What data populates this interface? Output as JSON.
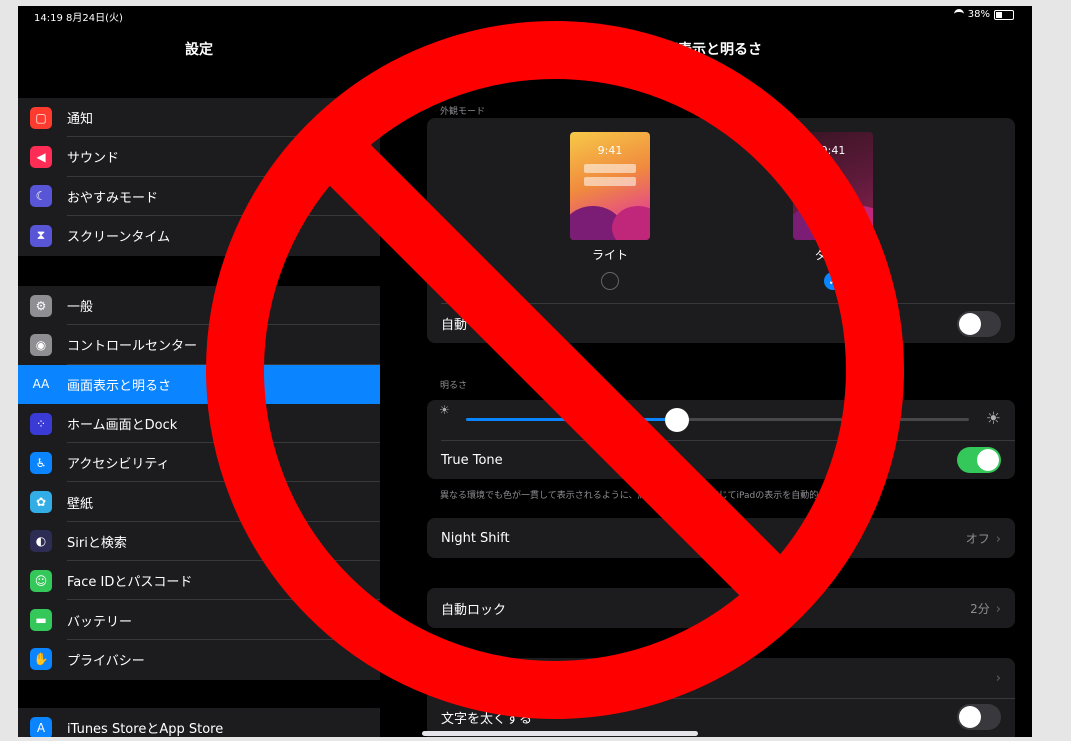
{
  "status": {
    "time": "14:19",
    "date": "8月24日(火)",
    "battery": "38%"
  },
  "sidebar": {
    "title": "設定",
    "groups": [
      [
        {
          "label": "通知",
          "icon": "notification-icon",
          "color": "#ff3b30"
        },
        {
          "label": "サウンド",
          "icon": "sound-icon",
          "color": "#ff2d55"
        },
        {
          "label": "おやすみモード",
          "icon": "moon-icon",
          "color": "#5856d6"
        },
        {
          "label": "スクリーンタイム",
          "icon": "hourglass-icon",
          "color": "#5856d6"
        }
      ],
      [
        {
          "label": "一般",
          "icon": "gear-icon",
          "color": "#8e8e93"
        },
        {
          "label": "コントロールセンター",
          "icon": "switches-icon",
          "color": "#8e8e93"
        },
        {
          "label": "画面表示と明るさ",
          "icon": "text-size-icon",
          "color": "#0a84ff",
          "selected": true
        },
        {
          "label": "ホーム画面とDock",
          "icon": "home-grid-icon",
          "color": "#3a3ad6"
        },
        {
          "label": "アクセシビリティ",
          "icon": "accessibility-icon",
          "color": "#0a84ff"
        },
        {
          "label": "壁紙",
          "icon": "flower-icon",
          "color": "#32ade6"
        },
        {
          "label": "Siriと検索",
          "icon": "siri-icon",
          "color": "#2c2c54"
        },
        {
          "label": "Face IDとパスコード",
          "icon": "faceid-icon",
          "color": "#34c759"
        },
        {
          "label": "バッテリー",
          "icon": "battery-icon",
          "color": "#34c759"
        },
        {
          "label": "プライバシー",
          "icon": "hand-icon",
          "color": "#0a84ff"
        }
      ],
      [
        {
          "label": "iTunes StoreとApp Store",
          "icon": "appstore-icon",
          "color": "#0a84ff"
        }
      ]
    ]
  },
  "main": {
    "title": "画面表示と明るさ",
    "appearance": {
      "section_label": "外観モード",
      "light_label": "ライト",
      "dark_label": "ダーク",
      "thumb_time": "9:41",
      "selected": "dark",
      "auto_label": "自動",
      "auto_on": false
    },
    "brightness": {
      "section_label": "明るさ",
      "level": 0.42,
      "true_tone_label": "True Tone",
      "true_tone_on": true,
      "footnote": "異なる環境でも色が一貫して表示されるように、周囲の照明状況に応じてiPadの表示を自動的に調整します。"
    },
    "night_shift": {
      "label": "Night Shift",
      "value": "オフ"
    },
    "auto_lock": {
      "label": "自動ロック",
      "value": "2分"
    },
    "text_size": {
      "label": "文字を太くする",
      "on": false
    }
  }
}
